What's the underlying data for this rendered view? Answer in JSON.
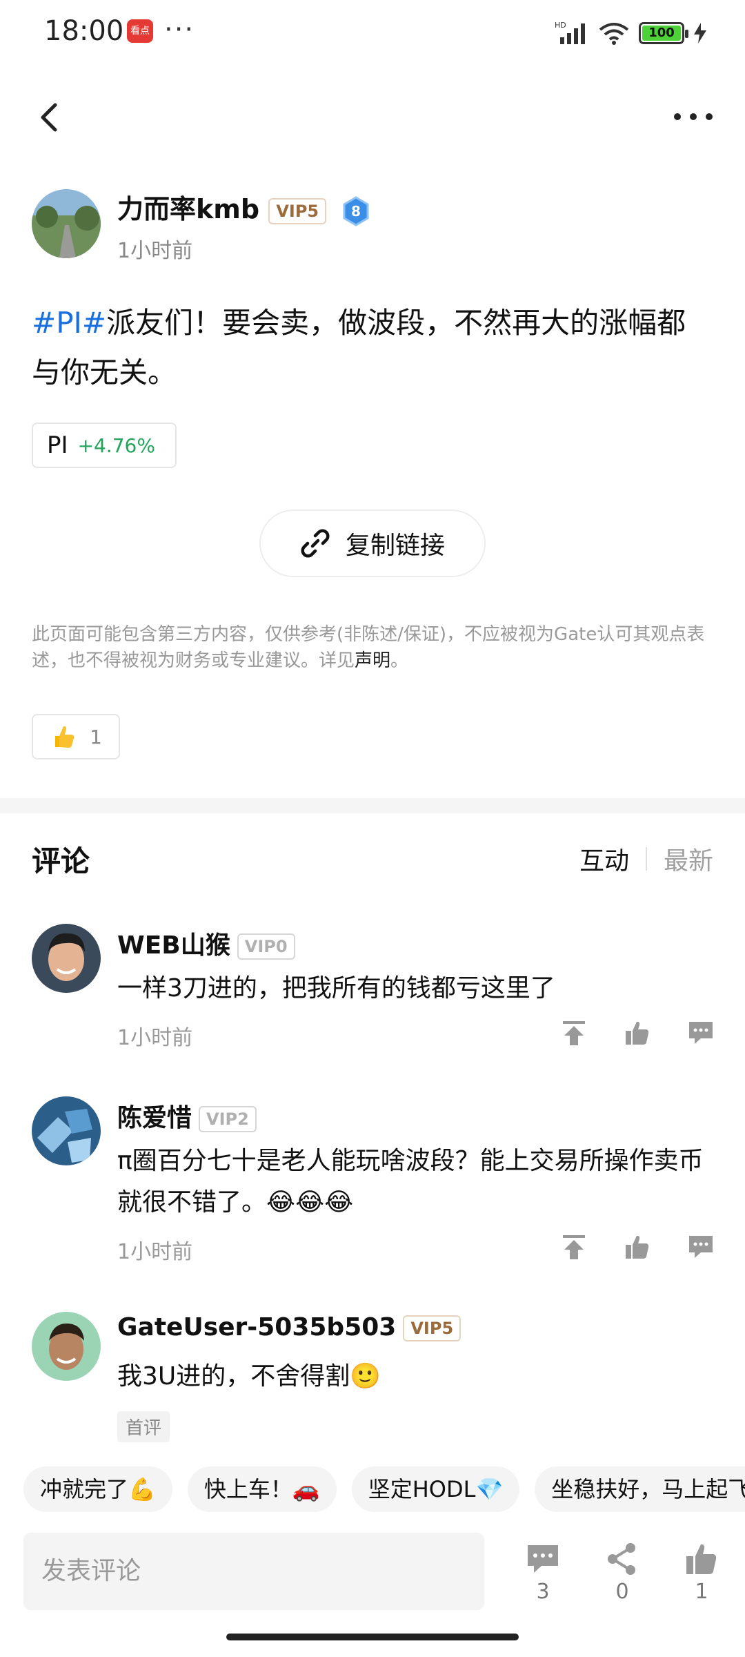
{
  "status_bar": {
    "time": "18:00",
    "app_icon_text": "看点",
    "more": "···",
    "battery": "100",
    "network": "HD"
  },
  "post": {
    "author": "力而率kmb",
    "vip": "VIP5",
    "level": "8",
    "time": "1小时前",
    "hashtag": "#PI#",
    "text": "派友们！要会卖，做波段，不然再大的涨幅都与你无关。",
    "coin": {
      "name": "PI",
      "change": "+4.76%"
    },
    "copy_link_label": "复制链接",
    "disclaimer_text": "此页面可能包含第三方内容，仅供参考(非陈述/保证)，不应被视为Gate认可其观点表述，也不得被视为财务或专业建议。详见",
    "disclaimer_link": "声明",
    "disclaimer_end": "。",
    "likes": "1"
  },
  "comments_section": {
    "title": "评论",
    "sort_active": "互动",
    "sort_inactive": "最新"
  },
  "comments": [
    {
      "name": "WEB山猴",
      "vip": "VIP0",
      "text": "一样3刀进的，把我所有的钱都亏这里了",
      "time": "1小时前"
    },
    {
      "name": "陈爱惜",
      "vip": "VIP2",
      "text": "π圈百分七十是老人能玩啥波段？能上交易所操作卖币就很不错了。😂😂😂",
      "time": "1小时前"
    },
    {
      "name": "GateUser-5035b503",
      "vip": "VIP5",
      "text": "我3U进的，不舍得割🙂",
      "tag": "首评"
    }
  ],
  "quick_replies": [
    "冲就完了💪",
    "快上车！🚗",
    "坚定HODL💎",
    "坐稳扶好，马上起飞"
  ],
  "bottom_bar": {
    "input_placeholder": "发表评论",
    "comment_count": "3",
    "share_count": "0",
    "like_count": "1"
  },
  "colors": {
    "hashtag": "#1a6fe0",
    "positive": "#22a55a",
    "vip_text": "#9c6b3c"
  }
}
